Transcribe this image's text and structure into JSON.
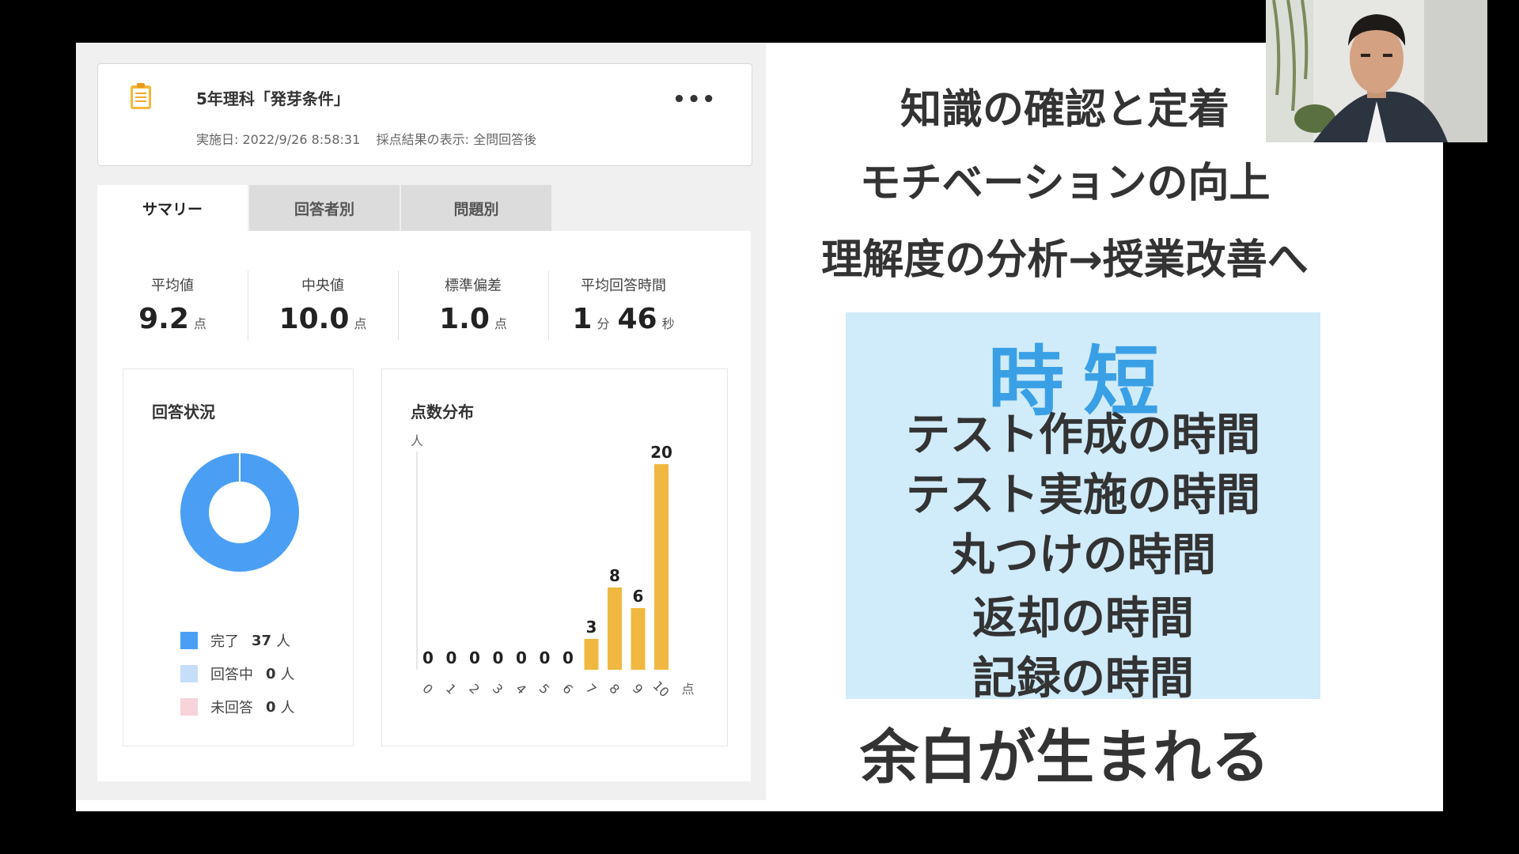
{
  "quiz": {
    "title": "5年理科「発芽条件」",
    "meta": "実施日: 2022/9/26 8:58:31    採点結果の表示: 全問回答後",
    "more": "•••"
  },
  "tabs": [
    "サマリー",
    "回答者別",
    "問題別"
  ],
  "stats": [
    {
      "label": "平均値",
      "value": "9.2",
      "unit": "点"
    },
    {
      "label": "中央値",
      "value": "10.0",
      "unit": "点"
    },
    {
      "label": "標準偏差",
      "value": "1.0",
      "unit": "点"
    },
    {
      "label": "平均回答時間",
      "min": "1",
      "min_unit": "分",
      "sec": "46",
      "sec_unit": "秒"
    }
  ],
  "status_card": {
    "title": "回答状況",
    "legend": [
      {
        "label": "完了",
        "count": "37",
        "unit": "人",
        "color": "#4a9ff5"
      },
      {
        "label": "回答中",
        "count": "0",
        "unit": "人",
        "color": "#c6def9"
      },
      {
        "label": "未回答",
        "count": "0",
        "unit": "人",
        "color": "#f8d3da"
      }
    ]
  },
  "dist_card": {
    "title": "点数分布"
  },
  "chart_data": {
    "type": "bar",
    "categories": [
      "0",
      "1",
      "2",
      "3",
      "4",
      "5",
      "6",
      "7",
      "8",
      "9",
      "10"
    ],
    "values": [
      0,
      0,
      0,
      0,
      0,
      0,
      0,
      3,
      8,
      6,
      20
    ],
    "ylabel": "人",
    "xlabel": "点",
    "ylim": [
      0,
      20
    ],
    "bar_color": "#f0b840",
    "grid": false
  },
  "slide": {
    "lines": [
      "知識の確認と定着",
      "モチベーションの向上",
      "理解度の分析→授業改善へ"
    ],
    "box_title": "時短",
    "box_lines": [
      "テスト作成の時間",
      "テスト実施の時間",
      "丸つけの時間",
      "返却の時間",
      "記録の時間"
    ],
    "bottom": "余白が生まれる",
    "box_color": "#d0ebfa",
    "accent": "#3aa0e6"
  }
}
